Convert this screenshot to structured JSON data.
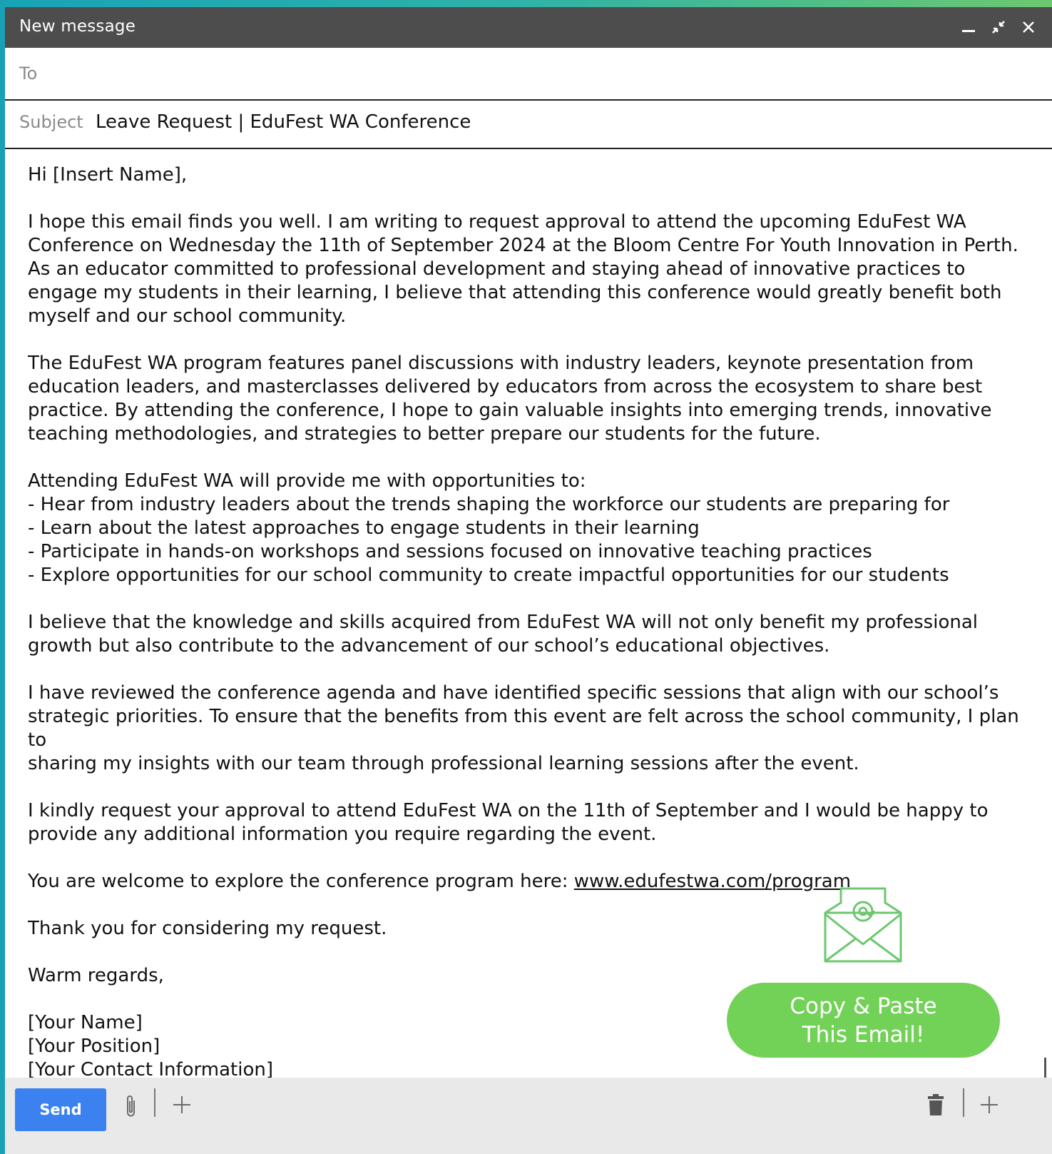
{
  "window": {
    "title": "New message"
  },
  "to": {
    "label": "To",
    "value": ""
  },
  "subject": {
    "label": "Subject",
    "value": "Leave Request | EduFest WA Conference"
  },
  "body": {
    "greeting": "Hi [Insert Name],",
    "para1": [
      "I hope this email finds you well. I am writing to request approval to attend the upcoming EduFest WA",
      "Conference on Wednesday the 11th of September 2024 at the Bloom Centre For Youth Innovation in Perth.",
      "As an educator committed to professional development and staying ahead of innovative practices to",
      "engage my students in their learning, I believe that attending this conference would greatly benefit both",
      "myself and our school community."
    ],
    "para2": [
      "The EduFest WA program features panel discussions with industry leaders, keynote presentation from",
      "education leaders, and masterclasses delivered by educators from across the ecosystem to share best",
      "practice. By attending the conference, I hope to gain valuable insights into emerging trends, innovative",
      "teaching methodologies, and strategies to better prepare our students for the future."
    ],
    "list_intro": "Attending EduFest WA will provide me with opportunities to:",
    "list_items": [
      "- Hear from industry leaders about the trends shaping the workforce our students are preparing for",
      "- Learn about the latest approaches to engage students in their learning",
      "- Participate in hands-on workshops and sessions focused on innovative teaching practices",
      "- Explore opportunities for our school community to create impactful opportunities for our students"
    ],
    "para3": [
      "I believe that the knowledge and skills acquired from EduFest WA will not only benefit my professional",
      "growth but also contribute to the advancement of our school’s educational objectives."
    ],
    "para4": [
      "I have reviewed the conference agenda and have identified specific sessions that align with our school’s",
      "strategic priorities. To ensure that the benefits from this event are felt across the school community, I plan to",
      "sharing my insights with our team through professional learning sessions after the event."
    ],
    "para5": [
      "I kindly request your approval to attend EduFest WA on the 11th of September and I would be happy to",
      "provide any additional information you require regarding the event."
    ],
    "program_text": "You are welcome to explore the conference program here: ",
    "program_link": "www.edufestwa.com/program",
    "thanks": "Thank you for considering my request.",
    "closing": "Warm regards,",
    "signature": [
      "[Your Name]",
      "[Your Position]",
      "[Your Contact Information]"
    ]
  },
  "copy_button": {
    "line1": "Copy & Paste",
    "line2": "This Email!"
  },
  "footer": {
    "send_label": "Send"
  },
  "icons": {
    "minimize": "minimize-icon",
    "collapse": "collapse-icon",
    "close": "close-icon",
    "mail": "envelope-at-icon",
    "attach": "paperclip-icon",
    "more": "plus-icon",
    "discard": "trash-icon"
  },
  "colors": {
    "titlebar": "#4d4d4d",
    "send": "#3b82f0",
    "copy_button": "#72d257",
    "accent_green": "#6cc86f",
    "accent_teal": "#1aa0b3"
  }
}
